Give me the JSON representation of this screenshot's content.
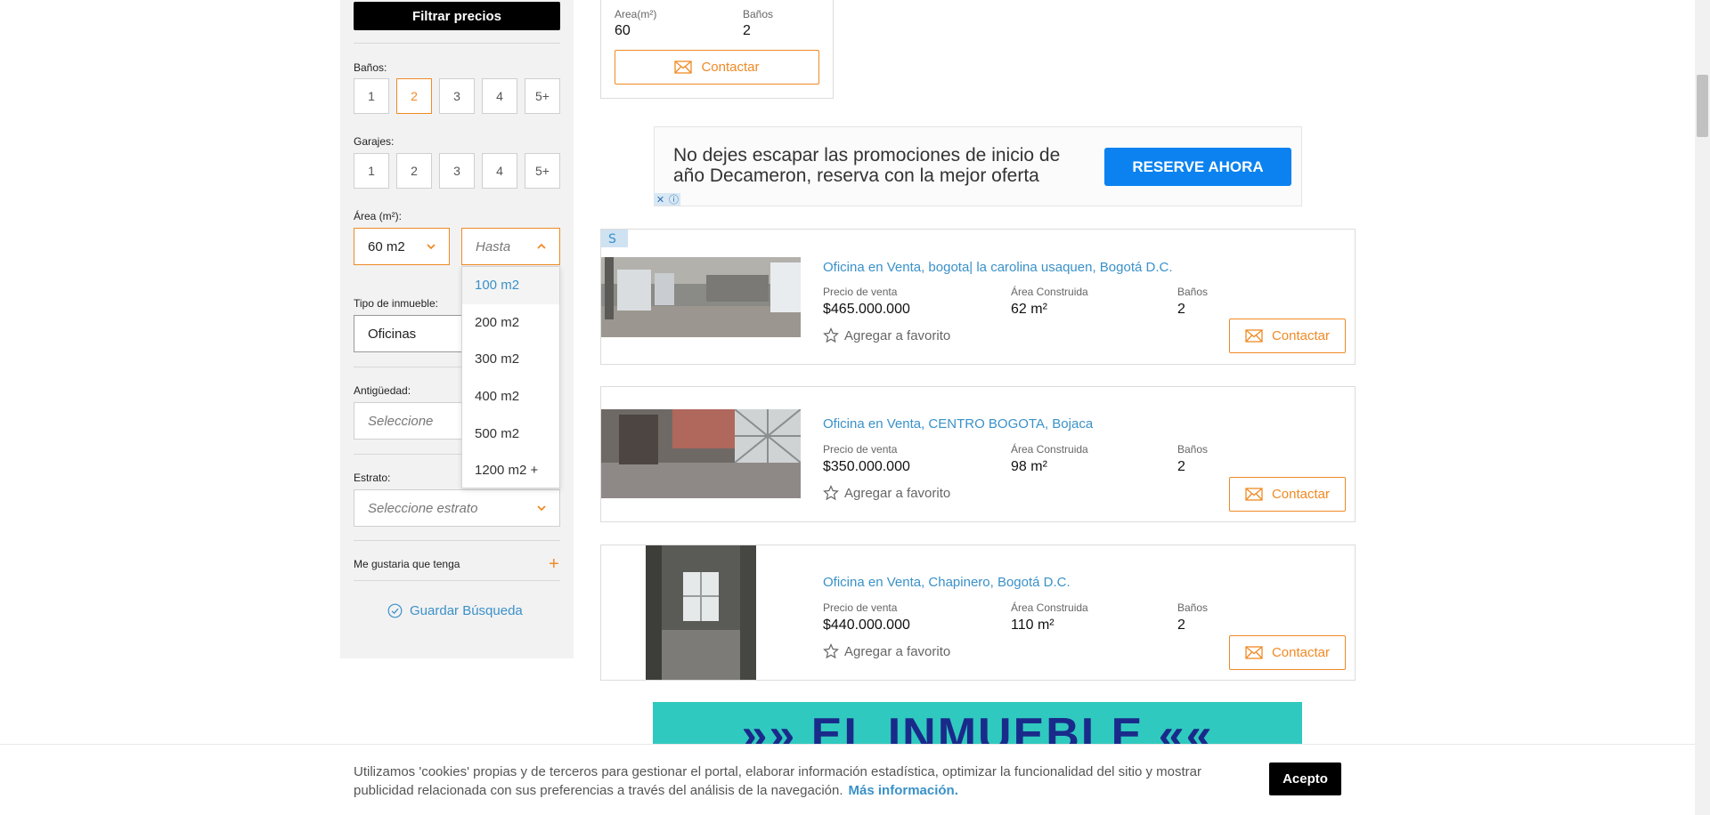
{
  "sidebar": {
    "filter_button": "Filtrar precios",
    "banos": {
      "label": "Baños:",
      "options": [
        "1",
        "2",
        "3",
        "4",
        "5+"
      ],
      "selected": "2"
    },
    "garajes": {
      "label": "Garajes:",
      "options": [
        "1",
        "2",
        "3",
        "4",
        "5+"
      ]
    },
    "area": {
      "label": "Área (m²):",
      "from_value": "60 m2",
      "to_placeholder": "Hasta",
      "options": [
        "100 m2",
        "200 m2",
        "300 m2",
        "400 m2",
        "500 m2",
        "1200 m2 +"
      ],
      "highlighted": "100 m2"
    },
    "tipo": {
      "label": "Tipo de inmueble:",
      "value": "Oficinas"
    },
    "antiguedad": {
      "label": "Antigüedad:",
      "placeholder": "Seleccione"
    },
    "estrato": {
      "label": "Estrato:",
      "placeholder": "Seleccione estrato"
    },
    "extras_label": "Me gustaria que tenga",
    "save_search": "Guardar Búsqueda"
  },
  "top_card": {
    "area_label": "Area(m²)",
    "area_value": "60",
    "banos_label": "Baños",
    "banos_value": "2",
    "contact": "Contactar"
  },
  "ad": {
    "text": "No dejes escapar las promociones de inicio de año Decameron, reserva con la mejor oferta",
    "button": "RESERVE AHORA"
  },
  "listings": [
    {
      "title": "Oficina en Venta, bogota| la carolina usaquen, Bogotá D.C.",
      "price_label": "Precio de venta",
      "price": "$465.000.000",
      "area_label": "Área Construida",
      "area": "62 m²",
      "banos_label": "Baños",
      "banos": "2",
      "favorite": "Agregar a favorito",
      "contact": "Contactar"
    },
    {
      "title": "Oficina en Venta, CENTRO BOGOTA, Bojaca",
      "price_label": "Precio de venta",
      "price": "$350.000.000",
      "area_label": "Área Construida",
      "area": "98 m²",
      "banos_label": "Baños",
      "banos": "2",
      "favorite": "Agregar a favorito",
      "contact": "Contactar"
    },
    {
      "title": "Oficina en Venta, Chapinero, Bogotá D.C.",
      "price_label": "Precio de venta",
      "price": "$440.000.000",
      "area_label": "Área Construida",
      "area": "110 m²",
      "banos_label": "Baños",
      "banos": "2",
      "favorite": "Agregar a favorito",
      "contact": "Contactar"
    }
  ],
  "banner": {
    "text": "»» EL INMUEBLE ««"
  },
  "cookie": {
    "text": "Utilizamos 'cookies' propias y de terceros para gestionar el portal, elaborar información estadística, optimizar la funcionalidad del sitio y mostrar publicidad relacionada con sus preferencias a través del análisis de la navegación.",
    "link": "Más información.",
    "accept": "Acepto"
  },
  "colors": {
    "accent": "#f08a24",
    "link": "#3a91c9",
    "ad_button": "#0b82f0",
    "banner": "#30c9bf"
  }
}
